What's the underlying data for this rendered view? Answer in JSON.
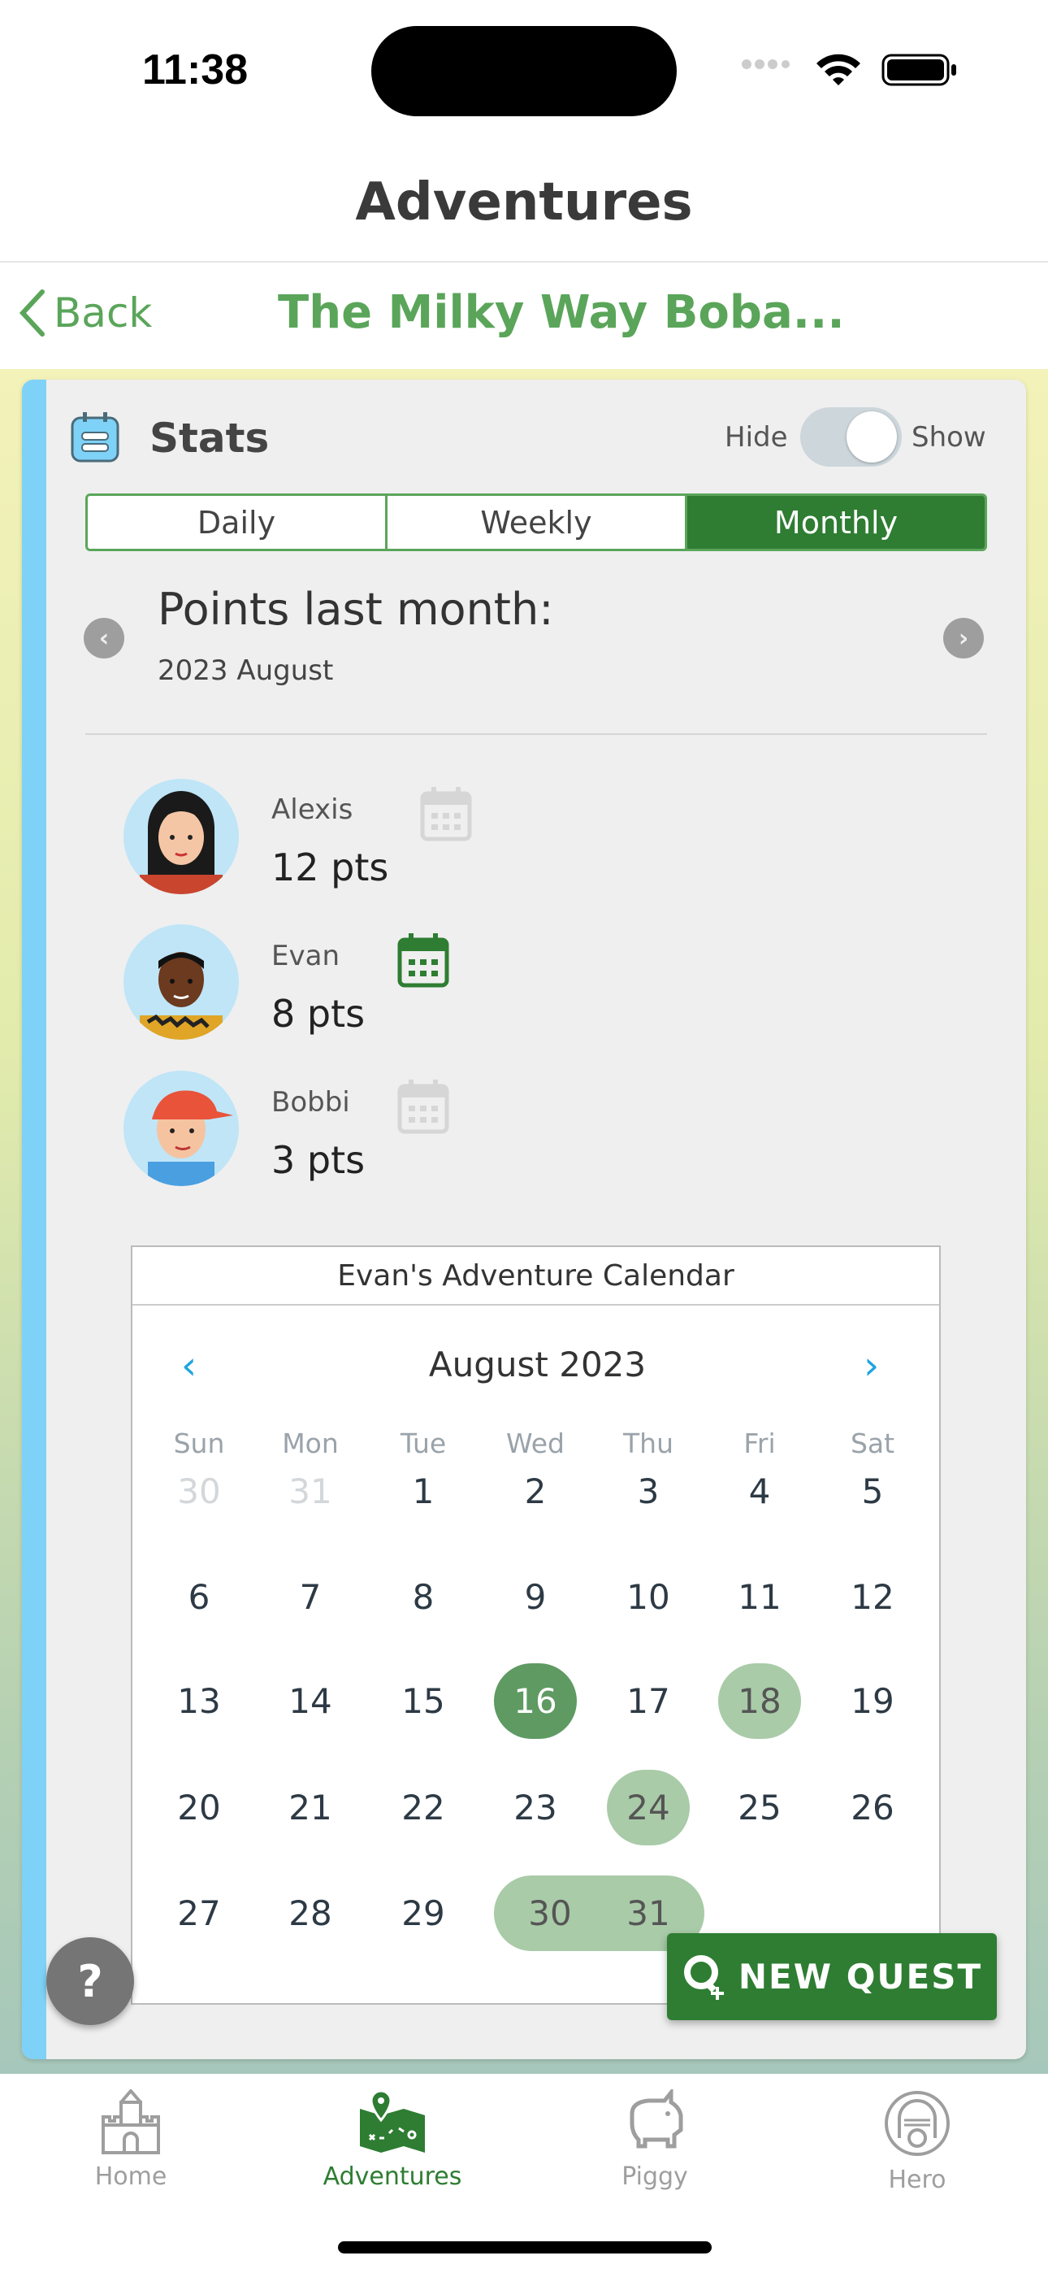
{
  "status": {
    "time": "11:38"
  },
  "header": {
    "title": "Adventures",
    "back_label": "Back",
    "subtitle": "The Milky Way Boba..."
  },
  "stats": {
    "title": "Stats",
    "hide_label": "Hide",
    "show_label": "Show",
    "toggle_on": true,
    "tabs": [
      {
        "label": "Daily"
      },
      {
        "label": "Weekly"
      },
      {
        "label": "Monthly"
      }
    ],
    "active_tab": "Monthly",
    "period_title": "Points last month:",
    "period": "2023 August",
    "members": [
      {
        "name": "Alexis",
        "points": "12 pts",
        "calendar_active": false
      },
      {
        "name": "Evan",
        "points": "8 pts",
        "calendar_active": true
      },
      {
        "name": "Bobbi",
        "points": "3 pts",
        "calendar_active": false
      }
    ]
  },
  "calendar": {
    "title": "Evan's Adventure Calendar",
    "month": "August 2023",
    "weekdays": [
      "Sun",
      "Mon",
      "Tue",
      "Wed",
      "Thu",
      "Fri",
      "Sat"
    ],
    "weeks": [
      [
        "30",
        "31",
        "1",
        "2",
        "3",
        "4",
        "5"
      ],
      [
        "6",
        "7",
        "8",
        "9",
        "10",
        "11",
        "12"
      ],
      [
        "13",
        "14",
        "15",
        "16",
        "17",
        "18",
        "19"
      ],
      [
        "20",
        "21",
        "22",
        "23",
        "24",
        "25",
        "26"
      ],
      [
        "27",
        "28",
        "29",
        "30",
        "31",
        "",
        ""
      ]
    ],
    "outside_days": [
      "30",
      "31"
    ],
    "selected_day": "16",
    "marked_days": [
      "18",
      "24",
      "30",
      "31"
    ]
  },
  "buttons": {
    "help": "?",
    "new_quest": "NEW QUEST"
  },
  "tabbar": [
    {
      "label": "Home",
      "icon": "castle-icon"
    },
    {
      "label": "Adventures",
      "icon": "map-icon",
      "active": true
    },
    {
      "label": "Piggy",
      "icon": "piggy-bank-icon"
    },
    {
      "label": "Hero",
      "icon": "knight-helmet-icon"
    }
  ],
  "colors": {
    "accent": "#2e7d32",
    "light_green": "#5aa55a",
    "marked": "#a9cba8",
    "selected": "#5e9a62",
    "card_bar": "#7fd2f7"
  }
}
